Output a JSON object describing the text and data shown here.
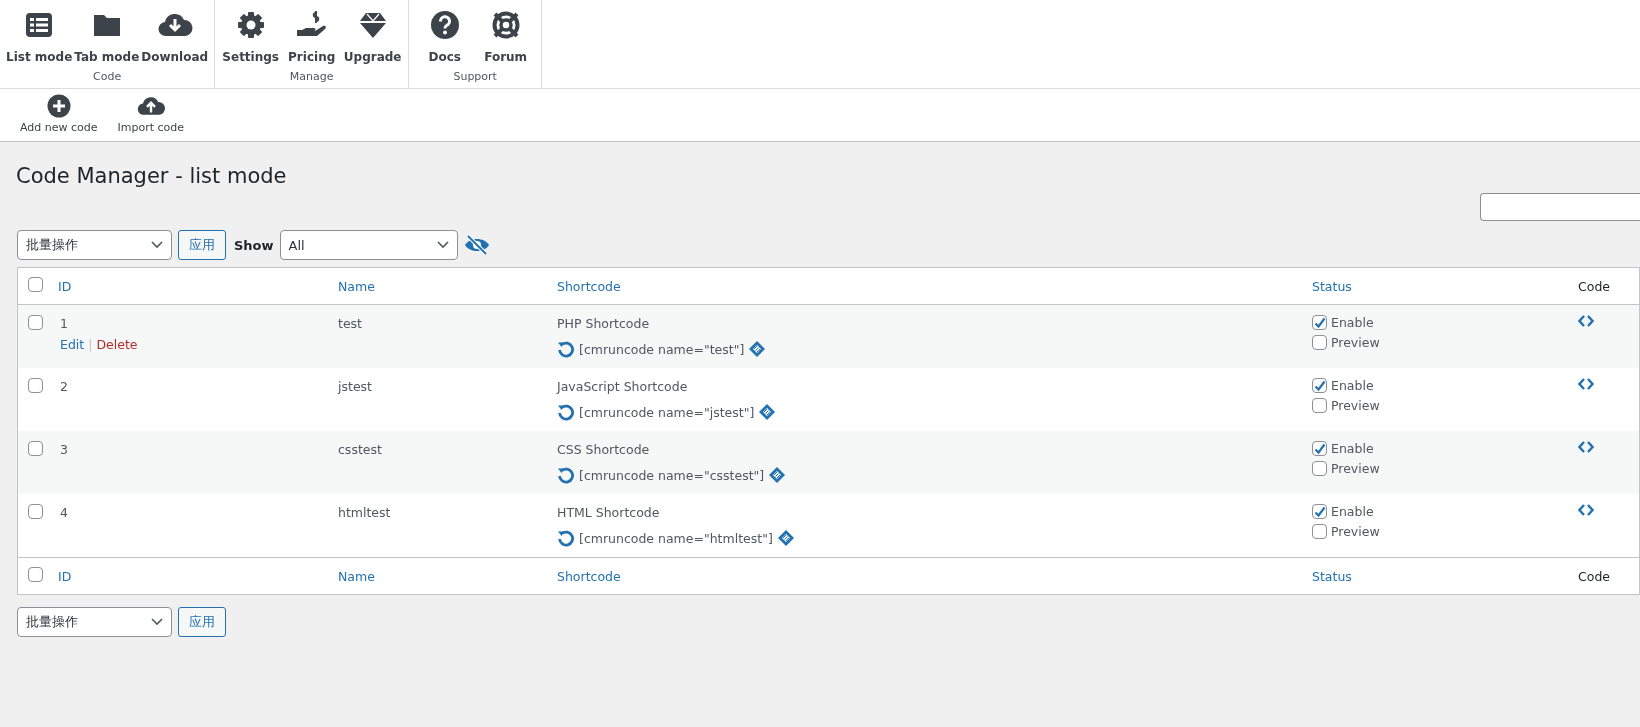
{
  "ribbon": {
    "groups": [
      {
        "label": "Code",
        "buttons": [
          {
            "label": "List mode",
            "kind": "list"
          },
          {
            "label": "Tab mode",
            "kind": "folder"
          },
          {
            "label": "Download",
            "kind": "download"
          }
        ]
      },
      {
        "label": "Manage",
        "buttons": [
          {
            "label": "Settings",
            "kind": "gear"
          },
          {
            "label": "Pricing",
            "kind": "pricing"
          },
          {
            "label": "Upgrade",
            "kind": "diamond"
          }
        ]
      },
      {
        "label": "Support",
        "buttons": [
          {
            "label": "Docs",
            "kind": "help"
          },
          {
            "label": "Forum",
            "kind": "lifebuoy"
          }
        ]
      }
    ]
  },
  "actions": [
    {
      "label": "Add new code",
      "kind": "plus"
    },
    {
      "label": "Import code",
      "kind": "upload"
    }
  ],
  "page_title": "Code Manager - list mode",
  "filters": {
    "bulk_action": "批量操作",
    "apply": "应用",
    "show_label": "Show",
    "show_value": "All"
  },
  "table": {
    "columns": [
      {
        "label": "ID",
        "sortable": true
      },
      {
        "label": "Name",
        "sortable": true
      },
      {
        "label": "Shortcode",
        "sortable": true
      },
      {
        "label": "Status",
        "sortable": true
      },
      {
        "label": "Code",
        "sortable": false
      }
    ],
    "header_checkbox": {
      "checked": false
    },
    "rows": [
      {
        "id": "1",
        "selected": false,
        "row_actions": [
          {
            "label": "Edit",
            "kind": "edit"
          },
          {
            "label": "Delete",
            "kind": "delete"
          }
        ],
        "row_actions_separator": "|",
        "name": "test",
        "type": "PHP Shortcode",
        "shortcode": "[cmruncode name=\"test\"]",
        "status": [
          {
            "label": "Enable",
            "checked": true
          },
          {
            "label": "Preview",
            "checked": false
          }
        ]
      },
      {
        "id": "2",
        "selected": false,
        "name": "jstest",
        "type": "JavaScript Shortcode",
        "shortcode": "[cmruncode name=\"jstest\"]",
        "status": [
          {
            "label": "Enable",
            "checked": true
          },
          {
            "label": "Preview",
            "checked": false
          }
        ]
      },
      {
        "id": "3",
        "selected": false,
        "name": "csstest",
        "type": "CSS Shortcode",
        "shortcode": "[cmruncode name=\"csstest\"]",
        "status": [
          {
            "label": "Enable",
            "checked": true
          },
          {
            "label": "Preview",
            "checked": false
          }
        ]
      },
      {
        "id": "4",
        "selected": false,
        "name": "htmltest",
        "type": "HTML Shortcode",
        "shortcode": "[cmruncode name=\"htmltest\"]",
        "status": [
          {
            "label": "Enable",
            "checked": true
          },
          {
            "label": "Preview",
            "checked": false
          }
        ]
      }
    ],
    "footer_checkbox": {
      "checked": false
    },
    "footer_columns": [
      {
        "label": "ID",
        "sortable": true
      },
      {
        "label": "Name",
        "sortable": true
      },
      {
        "label": "Shortcode",
        "sortable": true
      },
      {
        "label": "Status",
        "sortable": true
      },
      {
        "label": "Code",
        "sortable": false
      }
    ]
  },
  "bottom_bulk": {
    "bulk_action": "批量操作",
    "apply": "应用"
  }
}
